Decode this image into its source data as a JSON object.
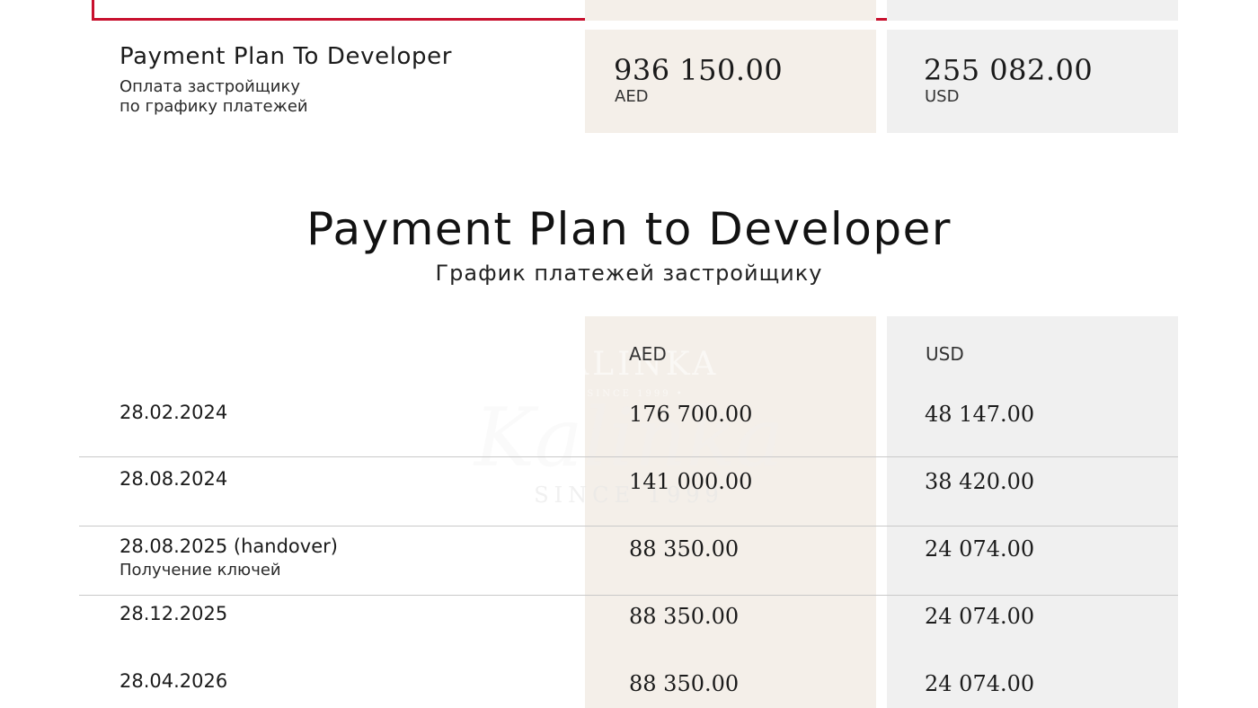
{
  "summary": {
    "title": "Payment Plan To Developer",
    "subtitle_line1": "Оплата застройщику",
    "subtitle_line2": "по графику платежей",
    "aed_amount": "936 150.00",
    "aed_label": "AED",
    "usd_amount": "255 082.00",
    "usd_label": "USD"
  },
  "section": {
    "title": "Payment Plan to Developer",
    "subtitle": "График платежей застройщику"
  },
  "table": {
    "headers": {
      "aed": "AED",
      "usd": "USD"
    },
    "rows": [
      {
        "date": "28.02.2024",
        "note": "",
        "aed": "176 700.00",
        "usd": "48 147.00"
      },
      {
        "date": "28.08.2024",
        "note": "",
        "aed": "141 000.00",
        "usd": "38 420.00"
      },
      {
        "date": "28.08.2025 (handover)",
        "note": "Получение ключей",
        "aed": "88 350.00",
        "usd": "24 074.00"
      },
      {
        "date": "28.12.2025",
        "note": "",
        "aed": "88 350.00",
        "usd": "24 074.00"
      },
      {
        "date": "28.04.2026",
        "note": "",
        "aed": "88 350.00",
        "usd": "24 074.00"
      }
    ]
  },
  "watermark": {
    "brand": "KALINKA",
    "since_small": "• SINCE 1999 •",
    "script": "Kalinka",
    "since_big": "SINCE 1999"
  },
  "colors": {
    "frame_red": "#c8102e",
    "aed_column_bg": "#f4efe9",
    "usd_column_bg": "#f0f0f0"
  }
}
